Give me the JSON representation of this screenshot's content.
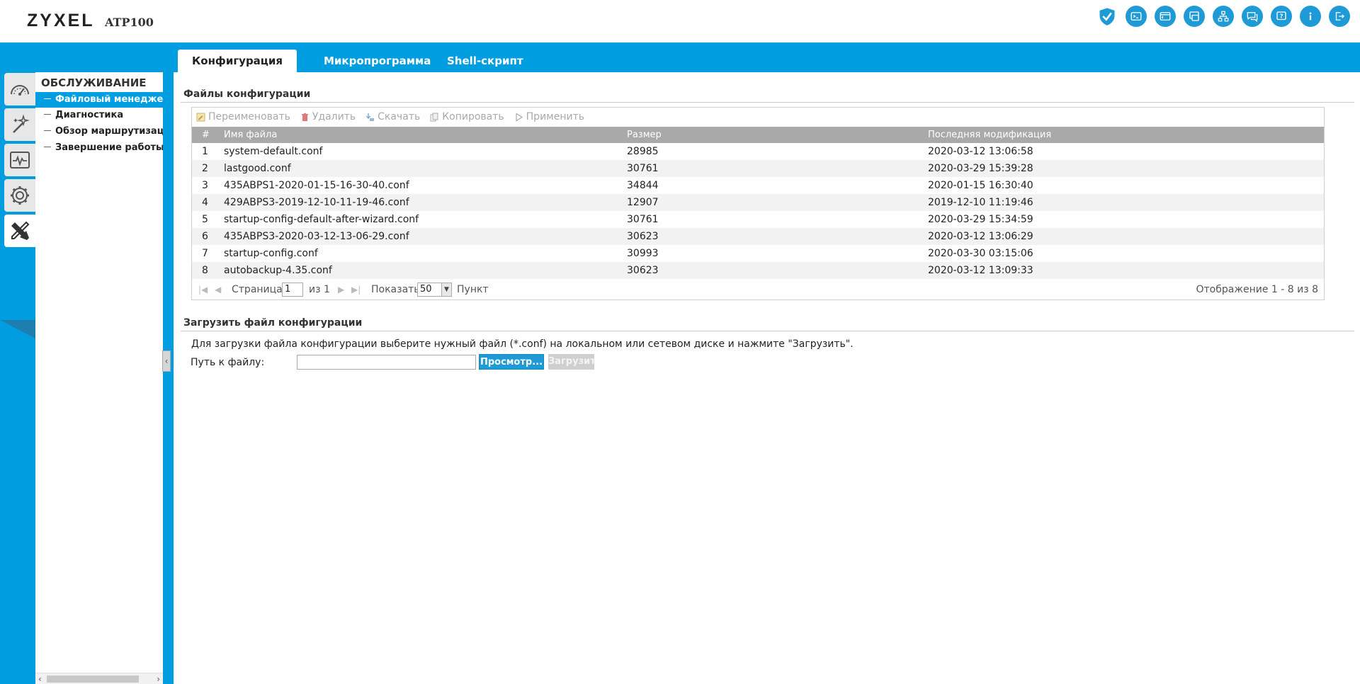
{
  "header": {
    "brand": "ZYXEL",
    "model": "ATP100",
    "icons": [
      "shield-check-icon",
      "console-icon",
      "cli-icon",
      "window-icon",
      "network-tree-icon",
      "chat-icon",
      "help-icon",
      "info-icon",
      "logout-icon"
    ]
  },
  "tabs": [
    {
      "label": "Конфигурация",
      "active": true
    },
    {
      "label": "Микропрограмма",
      "active": false
    },
    {
      "label": "Shell-скрипт",
      "active": false
    }
  ],
  "rail": [
    "dashboard-icon",
    "wizard-icon",
    "monitor-icon",
    "configuration-icon",
    "maintenance-icon"
  ],
  "nav": {
    "title": "ОБСЛУЖИВАНИЕ",
    "items": [
      {
        "label": "Файловый менеджер",
        "active": true
      },
      {
        "label": "Диагностика",
        "active": false
      },
      {
        "label": "Обзор маршрутизации",
        "active": false
      },
      {
        "label": "Завершение работы",
        "active": false
      }
    ]
  },
  "config_section": {
    "title": "Файлы конфигурации",
    "toolbar": {
      "rename": "Переименовать",
      "delete": "Удалить",
      "download": "Скачать",
      "copy": "Копировать",
      "apply": "Применить"
    },
    "columns": {
      "num": "#",
      "name": "Имя файла",
      "size": "Размер",
      "date": "Последняя модификация"
    },
    "rows": [
      {
        "num": "1",
        "name": "system-default.conf",
        "size": "28985",
        "date": "2020-03-12 13:06:58"
      },
      {
        "num": "2",
        "name": "lastgood.conf",
        "size": "30761",
        "date": "2020-03-29 15:39:28"
      },
      {
        "num": "3",
        "name": "435ABPS1-2020-01-15-16-30-40.conf",
        "size": "34844",
        "date": "2020-01-15 16:30:40"
      },
      {
        "num": "4",
        "name": "429ABPS3-2019-12-10-11-19-46.conf",
        "size": "12907",
        "date": "2019-12-10 11:19:46"
      },
      {
        "num": "5",
        "name": "startup-config-default-after-wizard.conf",
        "size": "30761",
        "date": "2020-03-29 15:34:59"
      },
      {
        "num": "6",
        "name": "435ABPS3-2020-03-12-13-06-29.conf",
        "size": "30623",
        "date": "2020-03-12 13:06:29"
      },
      {
        "num": "7",
        "name": "startup-config.conf",
        "size": "30993",
        "date": "2020-03-30 03:15:06"
      },
      {
        "num": "8",
        "name": "autobackup-4.35.conf",
        "size": "30623",
        "date": "2020-03-12 13:09:33"
      }
    ],
    "pager": {
      "page_label": "Страница",
      "page_value": "1",
      "of_label": "из 1",
      "show_label": "Показать",
      "show_value": "50",
      "item_label": "Пункт",
      "display_info": "Отображение 1 - 8 из 8"
    }
  },
  "upload_section": {
    "title": "Загрузить файл конфигурации",
    "hint": "Для загрузки файла конфигурации выберите нужный файл (*.conf) на локальном или сетевом диске и нажмите \"Загрузить\".",
    "path_label": "Путь к файлу:",
    "path_value": "",
    "browse_label": "Просмотр...",
    "upload_label": "Загрузить"
  },
  "colors": {
    "accent": "#009ee0",
    "header_row": "#a9a9a9",
    "alt_row": "#f2f2f2"
  }
}
